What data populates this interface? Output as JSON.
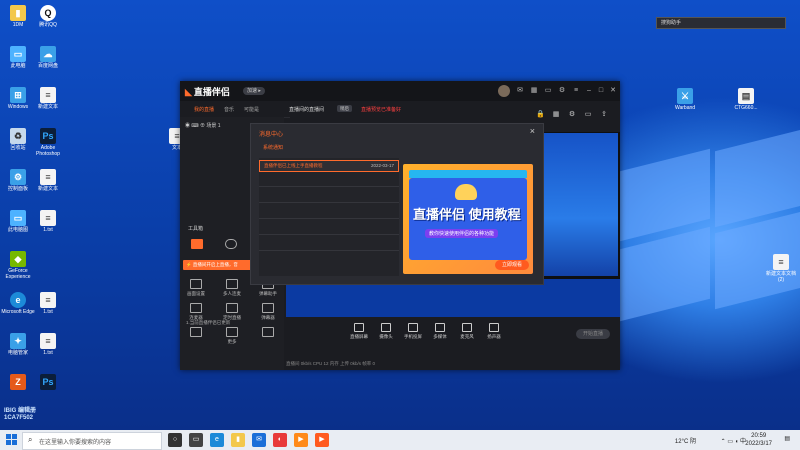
{
  "desktop": {
    "icons_left": [
      {
        "label": "1DM",
        "glyph": "▮",
        "kind": "folder"
      },
      {
        "label": "腾讯QQ",
        "glyph": "Q",
        "kind": "qq"
      },
      {
        "label": "此电脑",
        "glyph": "▭",
        "kind": "pc"
      },
      {
        "label": "百度网盘",
        "glyph": "☁",
        "kind": "app"
      },
      {
        "label": "Windows",
        "glyph": "⊞",
        "kind": "app"
      },
      {
        "label": "新建文本",
        "glyph": "≡",
        "kind": "doc"
      },
      {
        "label": "回收站",
        "glyph": "♻",
        "kind": "bin"
      },
      {
        "label": "Adobe Photoshop",
        "glyph": "Ps",
        "kind": "ps"
      },
      {
        "label": "控制面板",
        "glyph": "⚙",
        "kind": "app"
      },
      {
        "label": "新建文本",
        "glyph": "≡",
        "kind": "doc"
      },
      {
        "label": "此电脑图",
        "glyph": "▭",
        "kind": "pc"
      },
      {
        "label": "1.txt",
        "glyph": "≡",
        "kind": "doc"
      },
      {
        "label": "GeForce Experience",
        "glyph": "◆",
        "kind": "nv"
      },
      {
        "label": "",
        "glyph": "",
        "kind": "none"
      },
      {
        "label": "Microsoft Edge",
        "glyph": "e",
        "kind": "edge"
      },
      {
        "label": "1.txt",
        "glyph": "≡",
        "kind": "doc"
      },
      {
        "label": "电脑管家",
        "glyph": "✦",
        "kind": "app"
      },
      {
        "label": "1.txt",
        "glyph": "≡",
        "kind": "doc"
      },
      {
        "label": "",
        "glyph": "Z",
        "kind": "warn"
      },
      {
        "label": "",
        "glyph": "Ps",
        "kind": "ps"
      }
    ],
    "icons_right": [
      {
        "label": "Warband",
        "glyph": "⚔",
        "kind": "app"
      },
      {
        "label": "CTG660...",
        "glyph": "▤",
        "kind": "doc"
      },
      {
        "label": "新建文本文档 (2)",
        "glyph": "≡",
        "kind": "doc"
      }
    ],
    "middle_icon": {
      "label": "文本",
      "glyph": "≡"
    },
    "float_tag": "搜狗助手",
    "watermark": "IBIG 编辑册 1CA7F502"
  },
  "app": {
    "logo": "直播伴侣",
    "version": "加速 ▸",
    "tabs": [
      "我的直播",
      "音乐",
      "可能是"
    ],
    "scene_title": "直播间的直播间",
    "scene_chip": "稍后",
    "scene_hot": "直播预览已准备好",
    "scene_name": "场景 1",
    "tools_title": "工具箱",
    "live_banner": "⚡ 直播间开启上直播，音",
    "tools": [
      {
        "label": "画面设置"
      },
      {
        "label": "多人连麦"
      },
      {
        "label": "弹幕助手"
      },
      {
        "label": "连麦器"
      },
      {
        "label": "定时直播"
      },
      {
        "label": "弹幕器"
      },
      {
        "label": ""
      },
      {
        "label": "更多"
      },
      {
        "label": ""
      }
    ],
    "left_bottom": "1.当前直播伴侣已更新",
    "controls": [
      {
        "label": "直播屏幕"
      },
      {
        "label": "摄像头"
      },
      {
        "label": "手机投屏"
      },
      {
        "label": "多媒体"
      },
      {
        "label": "麦克风"
      },
      {
        "label": "扬声器"
      }
    ],
    "start_live": "开始直播",
    "status": "直播间 0kb/s   CPU 12   内存   上传 0kb/s     帧率 0"
  },
  "dialog": {
    "title": "消息中心",
    "section": "系统通知",
    "item_title": "直播伴侣已上线上手直播教程",
    "item_date": "2022-03-17",
    "promo_main": "直播伴侣 使用教程",
    "promo_sub": "教你快速使用伴侣的各种功能",
    "promo_btn": "立即观看"
  },
  "taskbar": {
    "search_placeholder": "在这里输入你要搜索的内容",
    "temp": "12°C 阴",
    "time": "20:59",
    "date": "2022/3/17",
    "apps": [
      {
        "glyph": "○",
        "color": "#333333"
      },
      {
        "glyph": "▭",
        "color": "#444444"
      },
      {
        "glyph": "e",
        "color": "#1c8ad8"
      },
      {
        "glyph": "▮",
        "color": "#f3c84b"
      },
      {
        "glyph": "✉",
        "color": "#1b6fd8"
      },
      {
        "glyph": "◐",
        "color": "#e83a3a"
      },
      {
        "glyph": "▶",
        "color": "#ff8a1a"
      },
      {
        "glyph": "▶",
        "color": "#ff5a1f"
      }
    ]
  },
  "colors": {
    "accent": "#ff6b2c",
    "wallpaper": "#0a3ea8"
  }
}
